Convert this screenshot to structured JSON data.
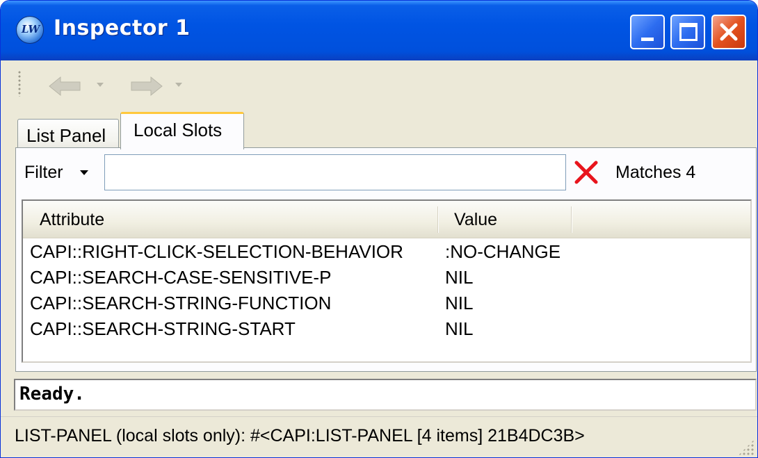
{
  "window": {
    "title": "Inspector 1",
    "app_icon": "lispworks-icon"
  },
  "titlebar_buttons": {
    "minimize": "minimize-icon",
    "maximize": "maximize-icon",
    "close": "close-icon"
  },
  "toolbar": {
    "back_icon": "back-arrow-icon",
    "forward_icon": "forward-arrow-icon"
  },
  "tabs": [
    {
      "label": "List Panel",
      "active": false
    },
    {
      "label": "Local Slots",
      "active": true
    }
  ],
  "filter": {
    "label": "Filter",
    "value": "",
    "placeholder": "",
    "matches_text": "Matches 4"
  },
  "table": {
    "columns": [
      "Attribute",
      "Value"
    ],
    "rows": [
      {
        "attribute": "CAPI::RIGHT-CLICK-SELECTION-BEHAVIOR",
        "value": ":NO-CHANGE"
      },
      {
        "attribute": "CAPI::SEARCH-CASE-SENSITIVE-P",
        "value": "NIL"
      },
      {
        "attribute": "CAPI::SEARCH-STRING-FUNCTION",
        "value": "NIL"
      },
      {
        "attribute": "CAPI::SEARCH-STRING-START",
        "value": "NIL"
      }
    ]
  },
  "echo_area": "Ready.",
  "status_bar": "LIST-PANEL (local slots only): #<CAPI:LIST-PANEL [4 items] 21B4DC3B>",
  "colors": {
    "titlebar": "#0054e3",
    "close_button": "#e3521f",
    "active_tab_highlight": "#ffc83c",
    "clear_icon": "#e8141c"
  }
}
